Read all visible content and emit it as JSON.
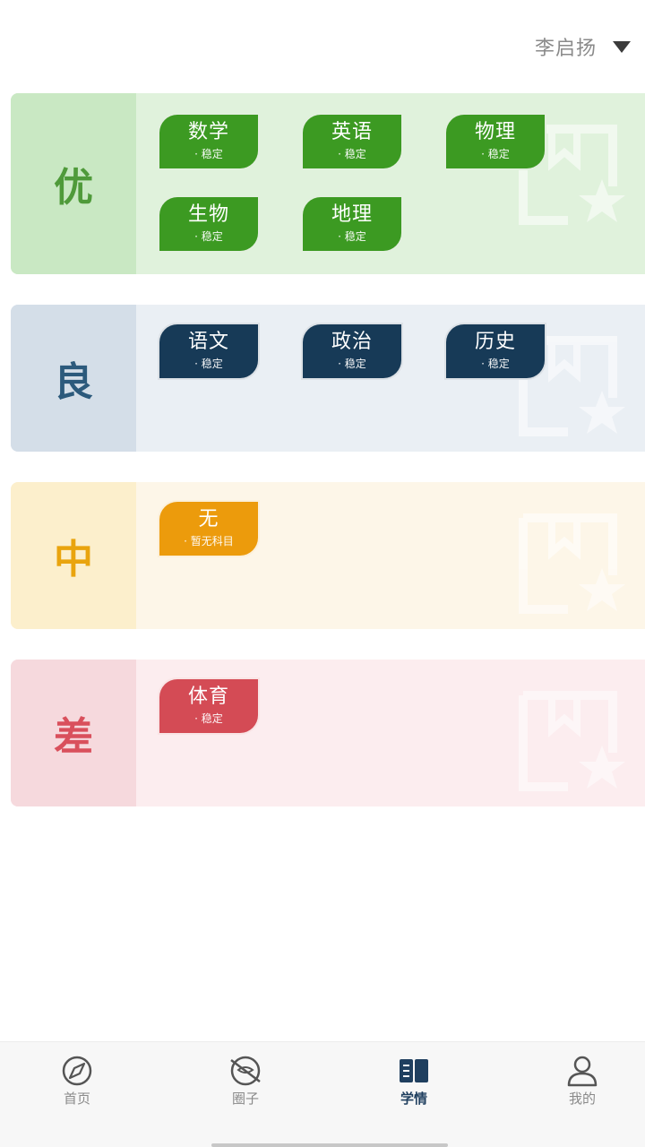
{
  "header": {
    "user_name": "李启扬"
  },
  "grades": [
    {
      "letter": "优",
      "subjects": [
        {
          "name": "数学",
          "status": "· 稳定"
        },
        {
          "name": "英语",
          "status": "· 稳定"
        },
        {
          "name": "物理",
          "status": "· 稳定"
        },
        {
          "name": "生物",
          "status": "· 稳定"
        },
        {
          "name": "地理",
          "status": "· 稳定"
        }
      ]
    },
    {
      "letter": "良",
      "subjects": [
        {
          "name": "语文",
          "status": "· 稳定"
        },
        {
          "name": "政治",
          "status": "· 稳定"
        },
        {
          "name": "历史",
          "status": "· 稳定"
        }
      ]
    },
    {
      "letter": "中",
      "subjects": [
        {
          "name": "无",
          "status": "· 暂无科目"
        }
      ]
    },
    {
      "letter": "差",
      "subjects": [
        {
          "name": "体育",
          "status": "· 稳定"
        }
      ]
    }
  ],
  "nav": {
    "items": [
      {
        "label": "首页",
        "icon": "compass-icon"
      },
      {
        "label": "圈子",
        "icon": "circle-chat-icon"
      },
      {
        "label": "学情",
        "icon": "book-icon"
      },
      {
        "label": "我的",
        "icon": "person-icon"
      }
    ],
    "active": "学情"
  },
  "colors": {
    "good": "#3c9a22",
    "fair": "#173a57",
    "mid": "#ec9b0c",
    "poor": "#d44b55"
  }
}
